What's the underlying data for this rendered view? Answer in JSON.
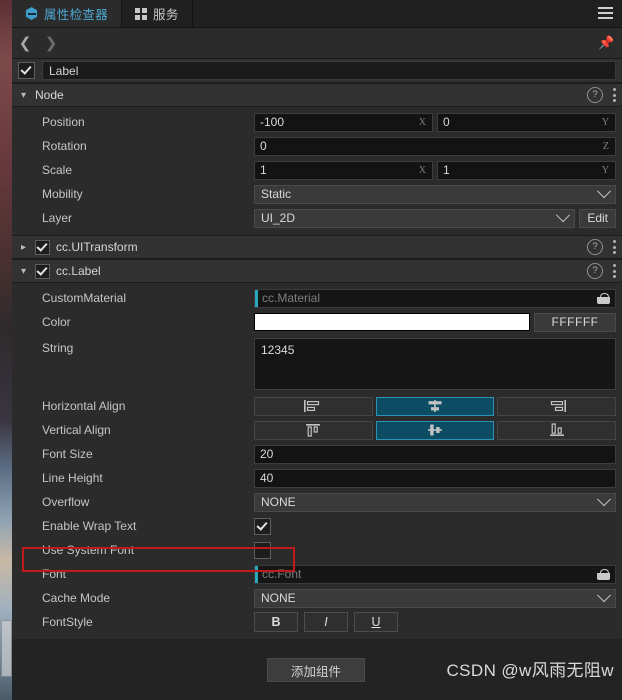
{
  "tabs": [
    {
      "label": "属性检查器",
      "icon": "inspector-hex-icon",
      "active": true
    },
    {
      "label": "服务",
      "icon": "grid-squares-icon",
      "active": false
    }
  ],
  "toolbar": {
    "menu_icon": "hamburger-icon",
    "back_icon": "chevron-left-icon",
    "forward_icon": "chevron-right-icon",
    "pin_icon": "pin-icon",
    "pin_glyph": "📌"
  },
  "node_name": {
    "enabled": true,
    "value": "Label"
  },
  "node_section": {
    "title": "Node",
    "expanded": true,
    "help_icon": "question-circle-icon",
    "menu_icon": "kebab-menu-icon",
    "rows": {
      "position": {
        "label": "Position",
        "x": "-100",
        "y": "0",
        "x_axis": "X",
        "y_axis": "Y"
      },
      "rotation": {
        "label": "Rotation",
        "z": "0",
        "z_axis": "Z"
      },
      "scale": {
        "label": "Scale",
        "x": "1",
        "y": "1",
        "x_axis": "X",
        "y_axis": "Y"
      },
      "mobility": {
        "label": "Mobility",
        "value": "Static"
      },
      "layer": {
        "label": "Layer",
        "value": "UI_2D",
        "edit_label": "Edit"
      }
    }
  },
  "uitransform": {
    "title": "cc.UITransform",
    "enabled": true,
    "expanded": false,
    "help_icon": "question-circle-icon",
    "menu_icon": "kebab-menu-icon"
  },
  "label_component": {
    "title": "cc.Label",
    "enabled": true,
    "expanded": true,
    "help_icon": "question-circle-icon",
    "menu_icon": "kebab-menu-icon",
    "rows": {
      "custom_material": {
        "label": "CustomMaterial",
        "placeholder": "cc.Material",
        "asset_icon": "asset-basket-icon"
      },
      "color": {
        "label": "Color",
        "swatch": "#FFFFFF",
        "hex": "FFFFFF"
      },
      "string": {
        "label": "String",
        "value": "12345"
      },
      "horizontal_align": {
        "label": "Horizontal Align",
        "options": [
          "align-left-icon",
          "align-center-icon",
          "align-right-icon"
        ],
        "selected": 1
      },
      "vertical_align": {
        "label": "Vertical Align",
        "options": [
          "align-top-icon",
          "align-middle-icon",
          "align-bottom-icon"
        ],
        "selected": 1
      },
      "font_size": {
        "label": "Font Size",
        "value": "20"
      },
      "line_height": {
        "label": "Line Height",
        "value": "40"
      },
      "overflow": {
        "label": "Overflow",
        "value": "NONE"
      },
      "enable_wrap_text": {
        "label": "Enable Wrap Text",
        "checked": true
      },
      "use_system_font": {
        "label": "Use System Font",
        "checked": false,
        "highlighted": true
      },
      "font": {
        "label": "Font",
        "placeholder": "cc.Font",
        "asset_icon": "asset-basket-icon"
      },
      "cache_mode": {
        "label": "Cache Mode",
        "value": "NONE"
      },
      "font_style": {
        "label": "FontStyle",
        "bold": "B",
        "italic": "I",
        "underline": "U"
      }
    }
  },
  "footer": {
    "add_component": "添加组件",
    "watermark": "CSDN @w风雨无阻w"
  },
  "colors": {
    "accent_teal": "#0c4d64",
    "accent_border": "#2d93b5",
    "tab_active_text": "#4ea8d4",
    "highlight_red": "#c01a1a",
    "asset_accent": "#2aa8bd"
  }
}
